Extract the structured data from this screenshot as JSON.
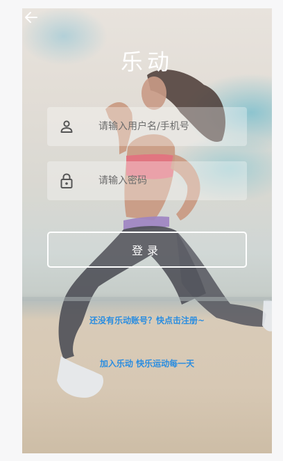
{
  "header": {
    "title": "乐动"
  },
  "form": {
    "username": {
      "placeholder": "请输入用户名/手机号",
      "value": ""
    },
    "password": {
      "placeholder": "请输入密码",
      "value": ""
    },
    "login_label": "登录"
  },
  "footer": {
    "register_text": "还没有乐动账号？快点击注册~",
    "slogan_text": "加入乐动 快乐运动每一天"
  },
  "colors": {
    "link": "#2a8de0",
    "button_border": "#ffffff"
  },
  "icons": {
    "back": "arrow-left-icon",
    "user": "person-icon",
    "lock": "lock-icon"
  }
}
